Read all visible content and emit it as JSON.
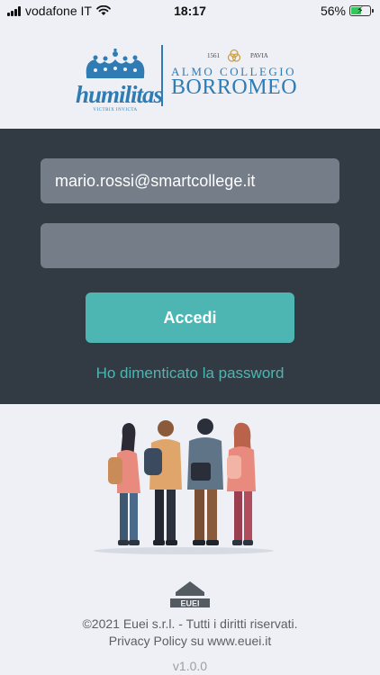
{
  "status_bar": {
    "carrier": "vodafone IT",
    "time": "18:17",
    "battery_percent": "56%",
    "battery_level": 0.56
  },
  "header": {
    "crest_motto": "humilitas",
    "crest_sub": "VICTRIX INVICTA",
    "year": "1561",
    "place": "PAVIA",
    "college_line1": "ALMO COLLEGIO",
    "college_line2": "BORROMEO"
  },
  "login": {
    "email_value": "mario.rossi@smartcollege.it",
    "password_value": "",
    "submit_label": "Accedi",
    "forgot_label": "Ho dimenticato la password"
  },
  "footer": {
    "company_logo_text": "EUEI",
    "copyright": "©2021 Euei s.r.l. - Tutti i diritti riservati.",
    "privacy": "Privacy Policy su www.euei.it",
    "version": "v1.0.0"
  },
  "colors": {
    "accent": "#4db6b2",
    "panel": "#323b43",
    "field": "#747d88",
    "brand_blue": "#2f7bb4",
    "background": "#eef0f5"
  }
}
